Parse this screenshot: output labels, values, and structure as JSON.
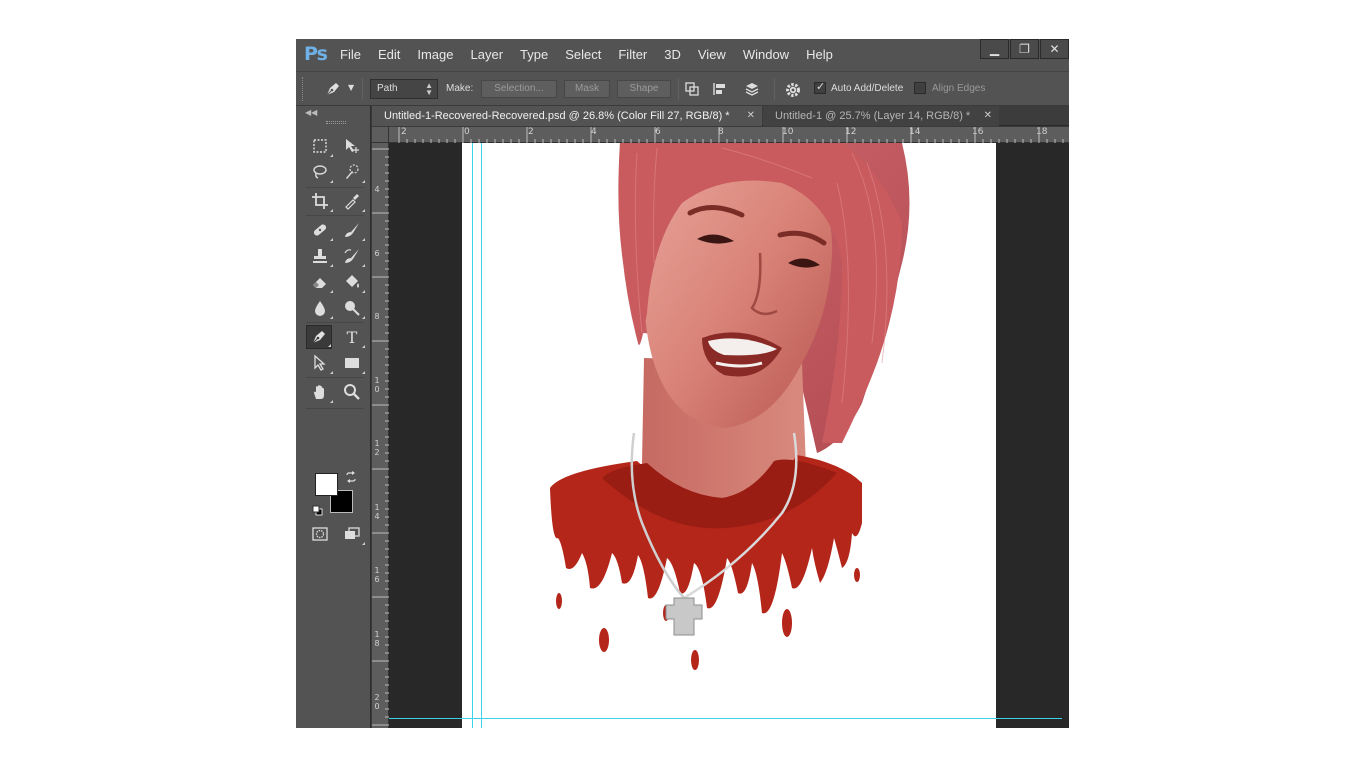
{
  "app": {
    "logo": "Ps",
    "menu": [
      "File",
      "Edit",
      "Image",
      "Layer",
      "Type",
      "Select",
      "Filter",
      "3D",
      "View",
      "Window",
      "Help"
    ],
    "window_controls": [
      "minimize-icon",
      "restore-icon",
      "close-icon"
    ]
  },
  "options_bar": {
    "mode_value": "Path",
    "make_label": "Make:",
    "selection_btn": "Selection...",
    "mask_btn": "Mask",
    "shape_btn": "Shape",
    "auto_add_delete_label": "Auto Add/Delete",
    "auto_add_delete_checked": true,
    "align_edges_label": "Align Edges",
    "align_edges_checked": false
  },
  "tabs": [
    {
      "label": "Untitled-1-Recovered-Recovered.psd @ 26.8% (Color Fill 27, RGB/8) *",
      "active": true
    },
    {
      "label": "Untitled-1 @ 25.7% (Layer 14, RGB/8) *",
      "active": false
    }
  ],
  "ruler_top_labels": [
    "2",
    "0",
    "2",
    "4",
    "6",
    "8",
    "10",
    "12",
    "14",
    "16",
    "18"
  ],
  "ruler_left_labels": [
    "4",
    "6",
    "8",
    "10",
    "12",
    "14",
    "16",
    "18",
    "20"
  ],
  "colors": {
    "foreground": "#ffffff",
    "background": "#000000",
    "guide": "#39d2e8",
    "hair": "#c95a5e",
    "shirt": "#b5261a",
    "skin": "#d98378"
  },
  "tools": {
    "active": "pen-tool"
  }
}
